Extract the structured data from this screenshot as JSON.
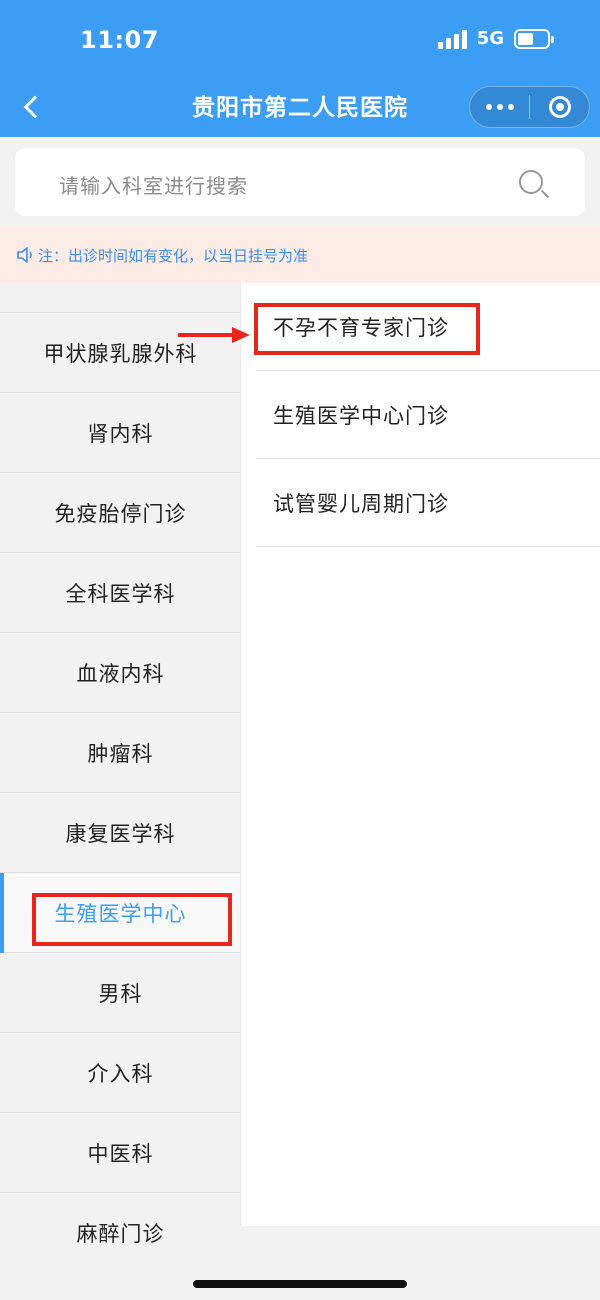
{
  "status_bar": {
    "time": "11:07",
    "network": "5G"
  },
  "header": {
    "title": "贵阳市第二人民医院"
  },
  "search": {
    "placeholder": "请输入科室进行搜索"
  },
  "notice": {
    "text": "注：出诊时间如有变化，以当日挂号为准"
  },
  "departments": [
    {
      "label": "甲状腺乳腺外科"
    },
    {
      "label": "肾内科"
    },
    {
      "label": "免疫胎停门诊"
    },
    {
      "label": "全科医学科"
    },
    {
      "label": "血液内科"
    },
    {
      "label": "肿瘤科"
    },
    {
      "label": "康复医学科"
    },
    {
      "label": "生殖医学中心",
      "active": true
    },
    {
      "label": "男科"
    },
    {
      "label": "介入科"
    },
    {
      "label": "中医科"
    },
    {
      "label": "麻醉门诊"
    }
  ],
  "clinics": [
    {
      "label": "不孕不育专家门诊"
    },
    {
      "label": "生殖医学中心门诊"
    },
    {
      "label": "试管婴儿周期门诊"
    }
  ],
  "colors": {
    "primary": "#3b9df4",
    "annotation": "#e8261c",
    "notice_bg": "#fdebe5"
  }
}
